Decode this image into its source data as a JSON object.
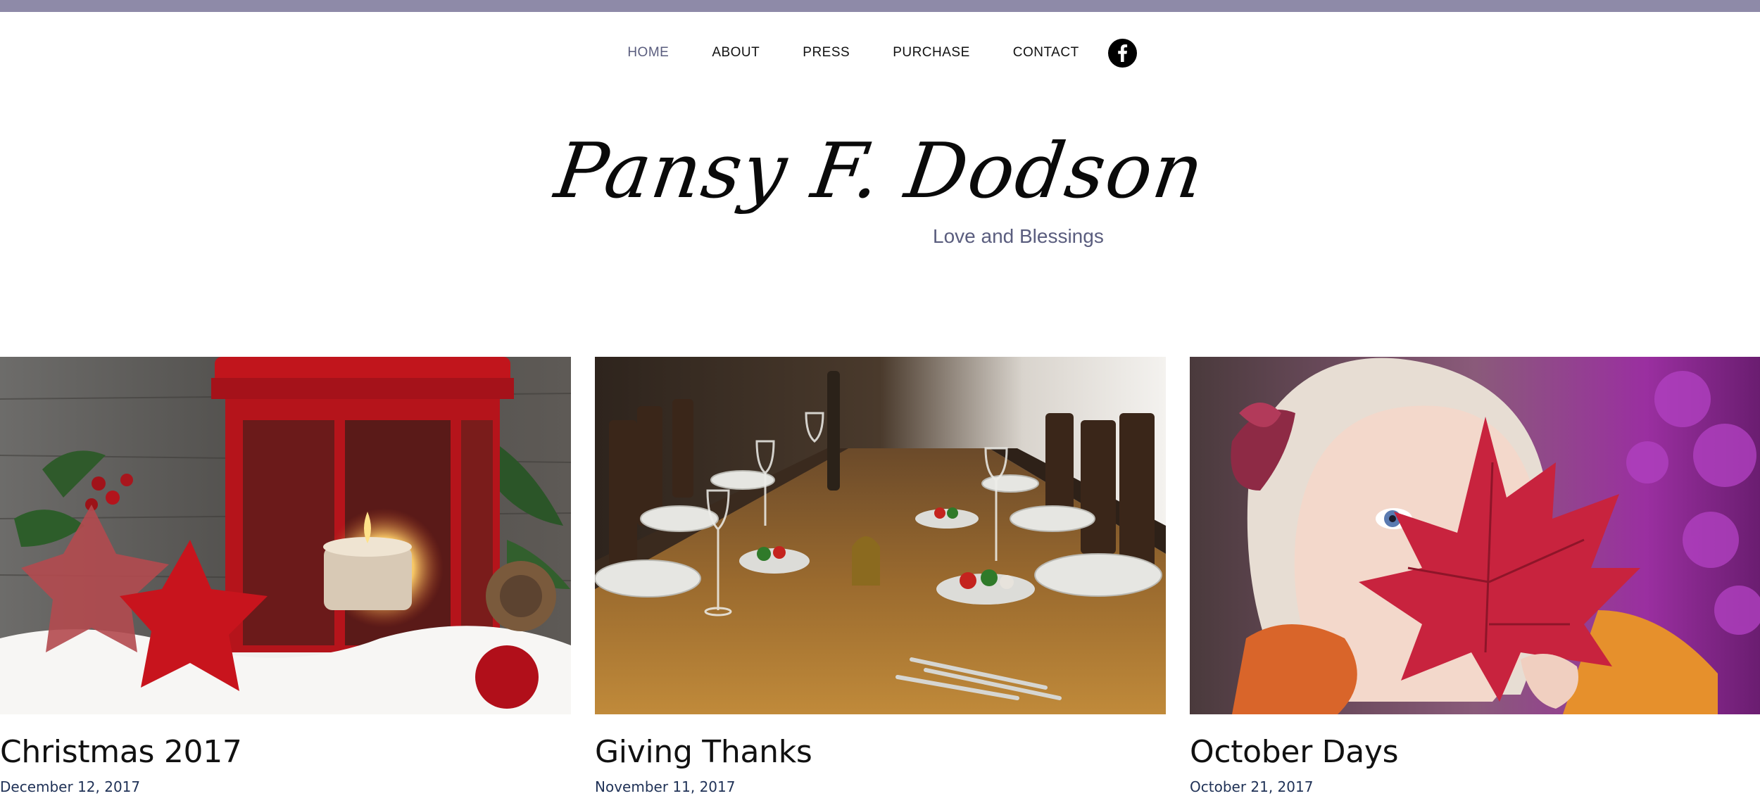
{
  "nav": {
    "items": [
      {
        "label": "HOME",
        "active": true
      },
      {
        "label": "ABOUT",
        "active": false
      },
      {
        "label": "PRESS",
        "active": false
      },
      {
        "label": "PURCHASE",
        "active": false
      },
      {
        "label": "CONTACT",
        "active": false
      }
    ],
    "social_icon": "facebook-icon"
  },
  "header": {
    "site_title": "Pansy F. Dodson",
    "tagline": "Love and Blessings"
  },
  "posts": [
    {
      "title": "Christmas 2017",
      "date": "December 12, 2017",
      "image": "christmas-lantern-photo"
    },
    {
      "title": "Giving Thanks",
      "date": "November 11, 2017",
      "image": "thanksgiving-table-photo"
    },
    {
      "title": "October Days",
      "date": "October 21, 2017",
      "image": "girl-with-maple-leaf-photo"
    }
  ],
  "colors": {
    "top_bar": "#8e8aa8",
    "accent": "#5a5d7e",
    "date": "#1f3156"
  }
}
